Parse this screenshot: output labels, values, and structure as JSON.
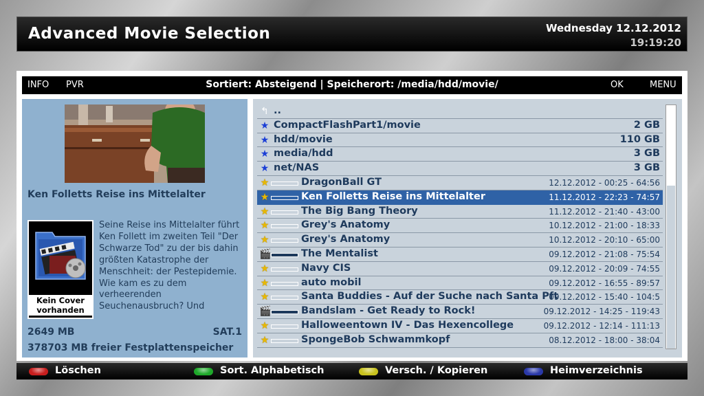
{
  "header": {
    "title": "Advanced Movie Selection",
    "date": "Wednesday  12.12.2012",
    "time": "19:19:20"
  },
  "infobar": {
    "info_label": "INFO",
    "pvr_label": "PVR",
    "sort_info": "Sortiert: Absteigend | Speicherort: /media/hdd/movie/",
    "ok_label": "OK",
    "menu_label": "MENU"
  },
  "detail": {
    "movie_name": "Ken Folletts Reise ins Mittelalter",
    "cover_text": "Kein Cover vorhanden",
    "description": "Seine Reise ins Mittelalter führt Ken Follett im zweiten Teil \"Der Schwarze Tod\" zu der bis dahin größten Katastrophe der Menschheit: der Pestepidemie. Wie kam es zu dem verheerenden Seuchenausbruch? Und",
    "size": "2649 MB",
    "channel": "SAT.1",
    "free_space": "378703 MB freier Festplattenspeicher"
  },
  "list": {
    "parent": "..",
    "locations": [
      {
        "name": "CompactFlashPart1/movie",
        "size": "2 GB"
      },
      {
        "name": "hdd/movie",
        "size": "110 GB"
      },
      {
        "name": "media/hdd",
        "size": "3 GB"
      },
      {
        "name": "net/NAS",
        "size": "3 GB"
      }
    ],
    "recordings": [
      {
        "name": "DragonBall GT",
        "date": "12.12.2012 - 00:25",
        "duration": "64:56",
        "progress": 0,
        "icon": "star"
      },
      {
        "name": "Ken Folletts Reise ins Mittelalter",
        "date": "11.12.2012 - 22:23",
        "duration": "74:57",
        "progress": 0,
        "icon": "star"
      },
      {
        "name": "The Big Bang Theory",
        "date": "11.12.2012 - 21:40",
        "duration": "43:00",
        "progress": 0,
        "icon": "star"
      },
      {
        "name": "Grey's Anatomy",
        "date": "10.12.2012 - 21:00",
        "duration": "18:33",
        "progress": 0,
        "icon": "star"
      },
      {
        "name": "Grey's Anatomy",
        "date": "10.12.2012 - 20:10",
        "duration": "65:00",
        "progress": 0,
        "icon": "star"
      },
      {
        "name": "The Mentalist",
        "date": "09.12.2012 - 21:08",
        "duration": "75:54",
        "progress": 1,
        "icon": "clapper"
      },
      {
        "name": "Navy CIS",
        "date": "09.12.2012 - 20:09",
        "duration": "74:55",
        "progress": 0,
        "icon": "star"
      },
      {
        "name": "auto mobil",
        "date": "09.12.2012 - 16:55",
        "duration": "89:57",
        "progress": 0,
        "icon": "star"
      },
      {
        "name": "Santa Buddies - Auf der Suche nach Santa Pft",
        "date": "09.12.2012 - 15:40",
        "duration": "104:5",
        "progress": 0,
        "icon": "star"
      },
      {
        "name": "Bandslam - Get Ready to Rock!",
        "date": "09.12.2012 - 14:25",
        "duration": "119:43",
        "progress": 1,
        "icon": "clapper"
      },
      {
        "name": "Halloweentown IV - Das Hexencollege",
        "date": "09.12.2012 - 12:14",
        "duration": "111:13",
        "progress": 0,
        "icon": "star"
      },
      {
        "name": "SpongeBob Schwammkopf",
        "date": "08.12.2012 - 18:00",
        "duration": "38:04",
        "progress": 0,
        "icon": "star"
      }
    ],
    "selected_index": 1
  },
  "buttons": {
    "red": {
      "label": "Löschen",
      "color": "#c81e1e"
    },
    "green": {
      "label": "Sort. Alphabetisch",
      "color": "#1ea82a"
    },
    "yellow": {
      "label": "Versch. / Kopieren",
      "color": "#c8c21e"
    },
    "blue": {
      "label": "Heimverzeichnis",
      "color": "#2a38a8"
    }
  },
  "scrollbar": {
    "thumb_start": 0.33,
    "thumb_end": 1.0
  }
}
